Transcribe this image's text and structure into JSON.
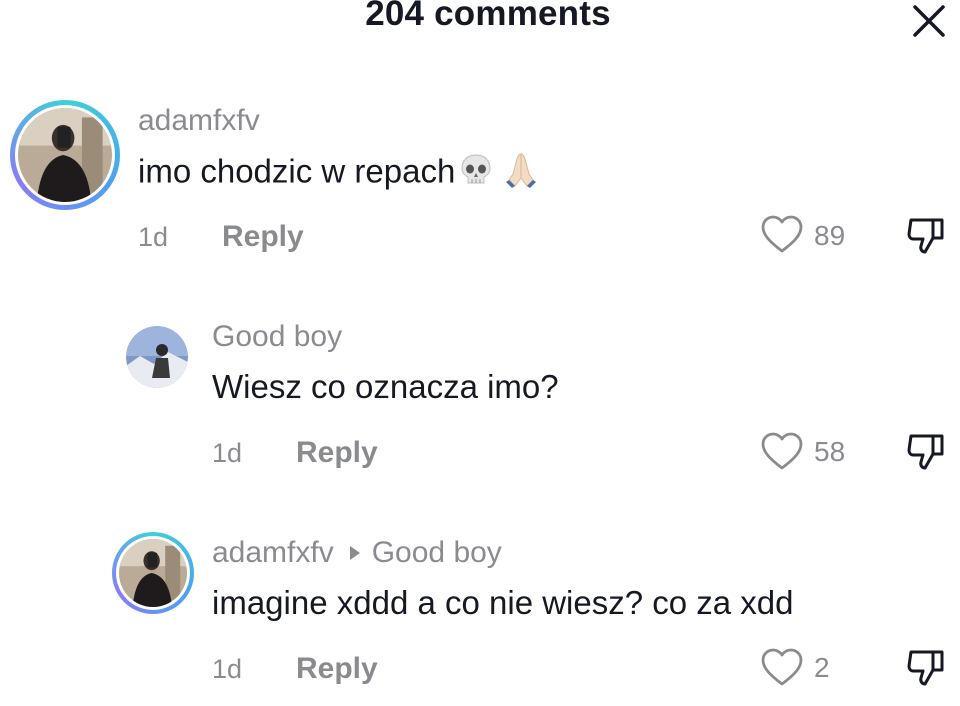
{
  "header": {
    "title": "204 comments",
    "close_icon": "close-icon"
  },
  "comments": [
    {
      "username": "adamfxfv",
      "text": "imo chodzic w repach",
      "emojis": [
        "skull-emoji",
        "folded-hands-emoji"
      ],
      "time": "1d",
      "reply_label": "Reply",
      "likes": "89"
    },
    {
      "username": "Good boy",
      "text": "Wiesz co oznacza imo?",
      "time": "1d",
      "reply_label": "Reply",
      "likes": "58"
    },
    {
      "username": "adamfxfv",
      "reply_to": "Good boy",
      "text": "imagine xddd a co nie wiesz? co za xdd",
      "time": "1d",
      "reply_label": "Reply",
      "likes": "2"
    }
  ],
  "colors": {
    "text": "#161823",
    "muted": "#8a8b91",
    "ring": "#3fd0d6"
  }
}
